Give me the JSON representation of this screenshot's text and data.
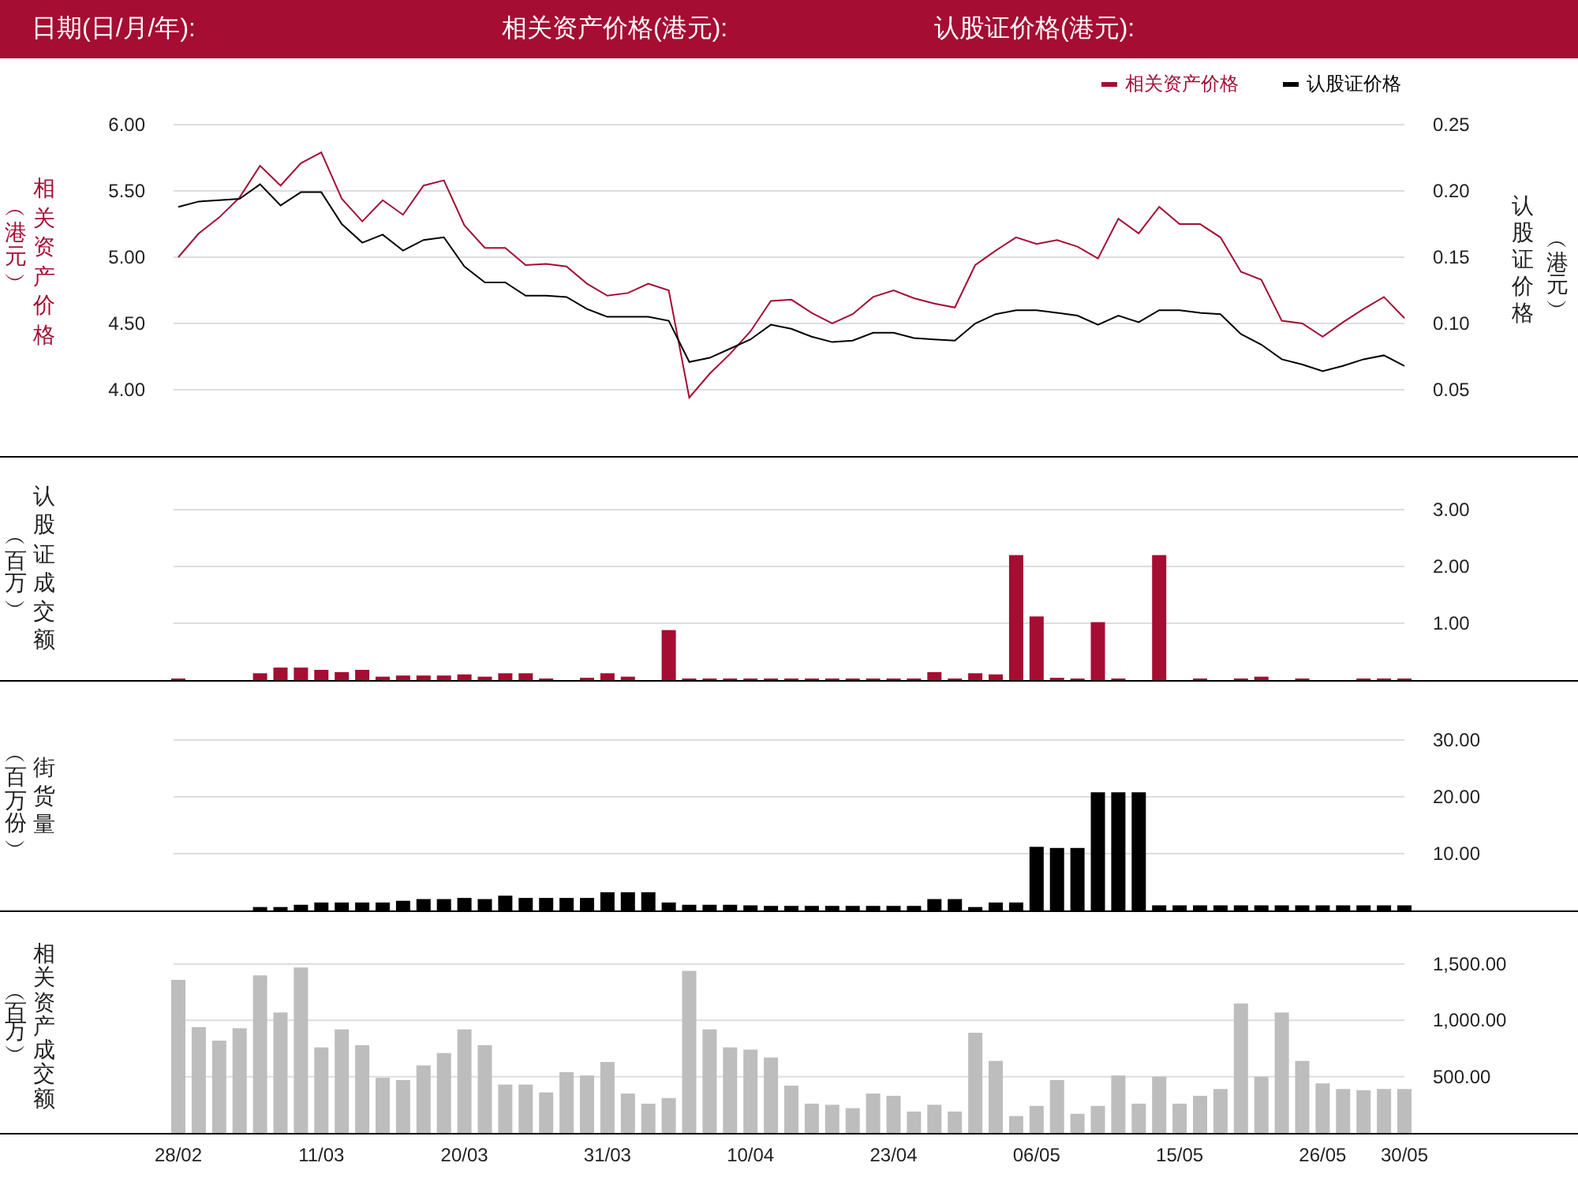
{
  "header": {
    "labels": [
      "日期(日/月/年):",
      "相关资产价格(港元):",
      "认股证价格(港元):"
    ]
  },
  "panels": [
    {
      "left_unit": "︵港元︶",
      "right_title": "认股证价格",
      "right_unit": "︵港元︶",
      "chart_data": {
        "type": "line",
        "ylabel": "相关资产价格",
        "grid": true,
        "legend": true,
        "ylim": [
          3.5,
          6.0
        ],
        "yticks": [
          {
            "value": 4,
            "label": "4.00"
          },
          {
            "value": 4.5,
            "label": "4.50"
          },
          {
            "value": 5,
            "label": "5.00"
          },
          {
            "value": 5.5,
            "label": "5.50"
          },
          {
            "value": 6,
            "label": "6.00"
          }
        ],
        "y2lim": [
          0,
          0.25
        ],
        "y2ticks": [
          {
            "value": 0.05,
            "label": "0.05"
          },
          {
            "value": 0.1,
            "label": "0.10"
          },
          {
            "value": 0.15,
            "label": "0.15"
          },
          {
            "value": 0.2,
            "label": "0.20"
          },
          {
            "value": 0.25,
            "label": "0.25"
          }
        ],
        "series": [
          {
            "name": "相关资产价格",
            "color": "#a50d33",
            "values": [
              5.0,
              5.18,
              5.3,
              5.45,
              5.69,
              5.54,
              5.71,
              5.79,
              5.44,
              5.27,
              5.43,
              5.32,
              5.54,
              5.58,
              5.24,
              5.07,
              5.07,
              4.94,
              4.95,
              4.93,
              4.8,
              4.71,
              4.73,
              4.8,
              4.75,
              3.94,
              4.12,
              4.27,
              4.44,
              4.67,
              4.68,
              4.58,
              4.5,
              4.57,
              4.7,
              4.75,
              4.69,
              4.65,
              4.62,
              4.94,
              5.05,
              5.15,
              5.1,
              5.13,
              5.08,
              4.99,
              5.29,
              5.18,
              5.38,
              5.25,
              5.25,
              5.15,
              4.89,
              4.83,
              4.52,
              4.5,
              4.4,
              4.51,
              4.61,
              4.7,
              4.54
            ]
          },
          {
            "name": "认股证价格",
            "color": "#000000",
            "axis": "y2",
            "values": [
              0.188,
              0.192,
              0.193,
              0.194,
              0.205,
              0.189,
              0.199,
              0.199,
              0.175,
              0.161,
              0.167,
              0.155,
              0.163,
              0.165,
              0.143,
              0.131,
              0.131,
              0.121,
              0.121,
              0.12,
              0.111,
              0.105,
              0.105,
              0.105,
              0.102,
              0.071,
              0.074,
              0.081,
              0.088,
              0.099,
              0.096,
              0.09,
              0.086,
              0.087,
              0.093,
              0.093,
              0.089,
              0.088,
              0.087,
              0.1,
              0.107,
              0.11,
              0.11,
              0.108,
              0.106,
              0.099,
              0.106,
              0.101,
              0.11,
              0.11,
              0.108,
              0.107,
              0.092,
              0.084,
              0.073,
              0.069,
              0.064,
              0.068,
              0.073,
              0.076,
              0.068
            ]
          }
        ]
      }
    },
    {
      "left_unit": "︵百万︶",
      "chart_data": {
        "type": "bar",
        "ylabel": "认股证成交额",
        "grid": true,
        "ylim": [
          0,
          3
        ],
        "yticks": [
          {
            "value": 1,
            "label": "1.00"
          },
          {
            "value": 2,
            "label": "2.00"
          },
          {
            "value": 3,
            "label": "3.00"
          }
        ],
        "series": [
          {
            "color": "#a50d33",
            "values": [
              0.02,
              0,
              0,
              0,
              0.12,
              0.22,
              0.22,
              0.18,
              0.14,
              0.18,
              0.06,
              0.08,
              0.08,
              0.08,
              0.1,
              0.06,
              0.12,
              0.12,
              0.02,
              0,
              0.04,
              0.12,
              0.06,
              0,
              0.88,
              0.02,
              0.02,
              0.02,
              0.02,
              0.02,
              0.02,
              0.02,
              0.02,
              0.02,
              0.02,
              0.02,
              0.02,
              0.14,
              0.02,
              0.12,
              0.1,
              2.2,
              1.12,
              0.04,
              0.02,
              1.02,
              0.02,
              0,
              2.2,
              0,
              0.02,
              0,
              0.02,
              0.06,
              0,
              0.02,
              0,
              0,
              0.02,
              0.02,
              0.02
            ]
          }
        ]
      }
    },
    {
      "left_unit": "︵百万份︶",
      "chart_data": {
        "type": "bar",
        "ylabel": "街货量",
        "grid": true,
        "ylim": [
          0,
          30
        ],
        "yticks": [
          {
            "value": 10,
            "label": "10.00"
          },
          {
            "value": 20,
            "label": "20.00"
          },
          {
            "value": 30,
            "label": "30.00"
          }
        ],
        "series": [
          {
            "color": "#000000",
            "values": [
              0,
              0,
              0,
              0,
              0.6,
              0.6,
              1.0,
              1.4,
              1.4,
              1.4,
              1.4,
              1.7,
              2.0,
              2.0,
              2.2,
              2.0,
              2.6,
              2.2,
              2.2,
              2.2,
              2.2,
              3.2,
              3.2,
              3.2,
              1.4,
              1.0,
              1.0,
              1.0,
              0.9,
              0.8,
              0.8,
              0.8,
              0.8,
              0.8,
              0.8,
              0.8,
              0.8,
              2.0,
              2.0,
              0.6,
              1.4,
              1.4,
              11.2,
              11.0,
              11.0,
              20.8,
              20.8,
              20.8,
              0.9,
              0.9,
              0.9,
              0.9,
              0.9,
              0.9,
              0.9,
              0.9,
              0.9,
              0.9,
              0.9,
              0.9,
              0.9
            ]
          }
        ]
      }
    },
    {
      "left_unit": "︵百万︶",
      "date_labels": [
        "28/02",
        "11/03",
        "20/03",
        "31/03",
        "10/04",
        "23/04",
        "06/05",
        "15/05",
        "26/05",
        "30/05"
      ],
      "chart_data": {
        "type": "bar",
        "ylabel": "相关资产成交额",
        "grid": true,
        "ylim": [
          0,
          1500
        ],
        "yticks": [
          {
            "value": 500,
            "label": "500.00"
          },
          {
            "value": 1000,
            "label": "1,000.00"
          },
          {
            "value": 1500,
            "label": "1,500.00"
          }
        ],
        "series": [
          {
            "color": "#bdbdbd",
            "values": [
              1360,
              940,
              820,
              930,
              1400,
              1070,
              1470,
              760,
              920,
              780,
              490,
              470,
              600,
              710,
              920,
              780,
              430,
              430,
              360,
              540,
              510,
              630,
              350,
              260,
              310,
              1440,
              920,
              760,
              740,
              670,
              420,
              260,
              250,
              220,
              350,
              330,
              190,
              250,
              190,
              890,
              640,
              150,
              240,
              470,
              170,
              240,
              510,
              260,
              500,
              260,
              330,
              390,
              1150,
              500,
              1070,
              640,
              440,
              390,
              380,
              390,
              390
            ]
          }
        ]
      }
    }
  ]
}
